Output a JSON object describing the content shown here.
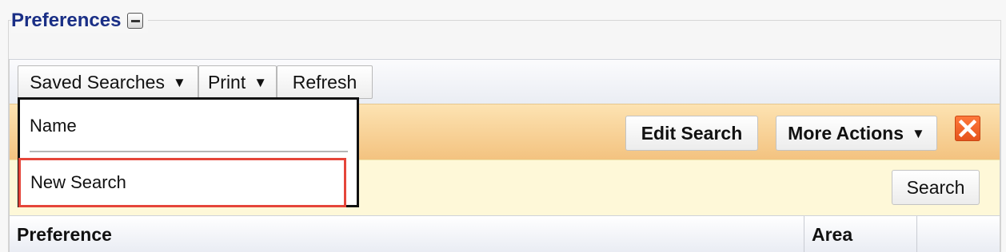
{
  "section": {
    "title": "Preferences"
  },
  "toolbar": {
    "saved_searches_label": "Saved Searches",
    "print_label": "Print",
    "refresh_label": "Refresh",
    "dropdown_arrow": "▼"
  },
  "actions": {
    "edit_search_label": "Edit Search",
    "more_actions_label": "More Actions"
  },
  "search": {
    "button_label": "Search"
  },
  "table": {
    "columns": [
      "Preference",
      "Area"
    ]
  },
  "saved_searches_menu": {
    "header_label": "Name",
    "items": [
      "New Search"
    ]
  },
  "colors": {
    "title": "#1a2f86",
    "orange_band": "#f3c27f",
    "yellow_band": "#fef8d8",
    "close_icon": "#e5521c",
    "highlight_border": "#e5453a"
  },
  "icons": {
    "collapse": "minus-icon",
    "close": "close-icon"
  }
}
